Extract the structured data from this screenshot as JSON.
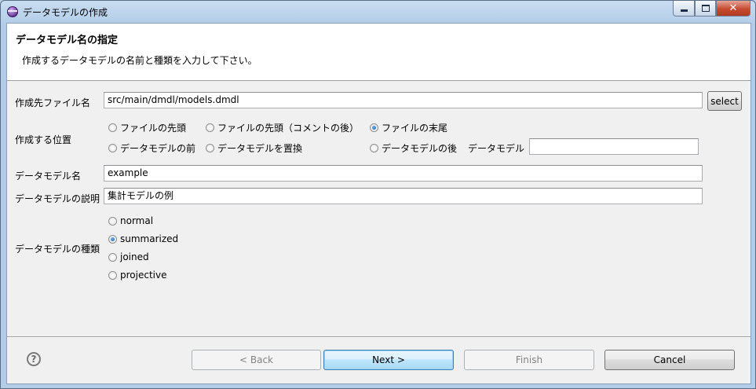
{
  "window": {
    "title": "データモデルの作成",
    "min_glyph": "",
    "max_glyph": "",
    "close_glyph": "✕"
  },
  "banner": {
    "title": "データモデル名の指定",
    "description": "作成するデータモデルの名前と種類を入力して下さい。"
  },
  "form": {
    "target_file": {
      "label": "作成先ファイル名",
      "value": "src/main/dmdl/models.dmdl",
      "button": "select"
    },
    "position": {
      "label": "作成する位置",
      "options": [
        {
          "label": "ファイルの先頭",
          "checked": false
        },
        {
          "label": "ファイルの先頭（コメントの後）",
          "checked": false
        },
        {
          "label": "ファイルの末尾",
          "checked": true
        },
        {
          "label": "データモデルの前",
          "checked": false
        },
        {
          "label": "データモデルを置換",
          "checked": false
        },
        {
          "label": "データモデルの後",
          "checked": false
        }
      ],
      "model_label": "データモデル",
      "model_value": ""
    },
    "model_name": {
      "label": "データモデル名",
      "value": "example"
    },
    "model_description": {
      "label": "データモデルの説明",
      "value": "集計モデルの例"
    },
    "model_kind": {
      "label": "データモデルの種類",
      "options": [
        {
          "label": "normal",
          "checked": false
        },
        {
          "label": "summarized",
          "checked": true
        },
        {
          "label": "joined",
          "checked": false
        },
        {
          "label": "projective",
          "checked": false
        }
      ]
    }
  },
  "footer": {
    "help_glyph": "?",
    "back": "< Back",
    "next": "Next >",
    "finish": "Finish",
    "cancel": "Cancel"
  }
}
